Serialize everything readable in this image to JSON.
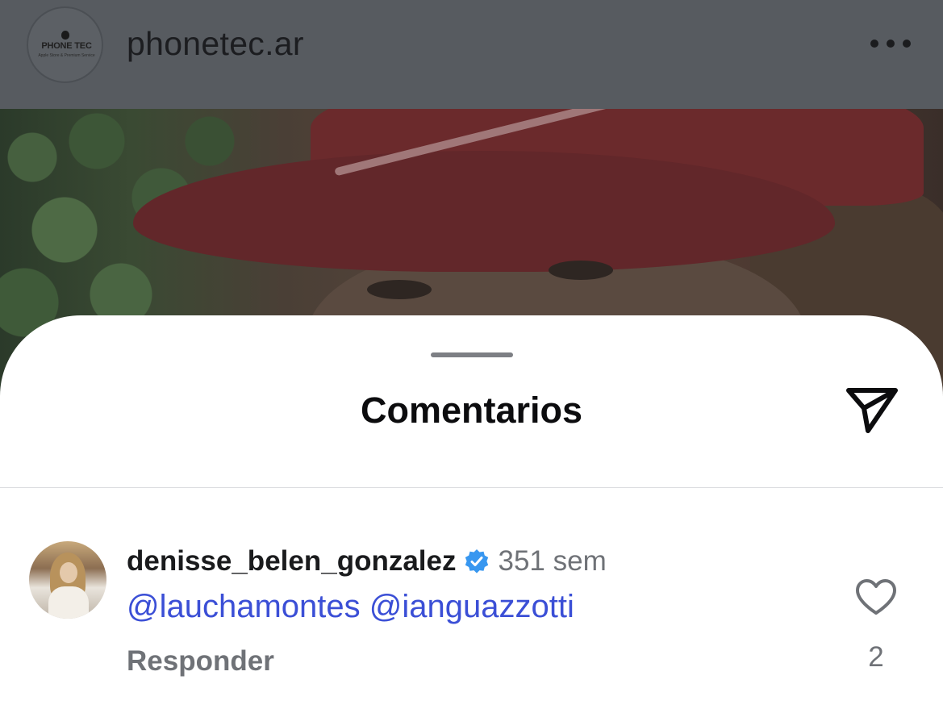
{
  "header": {
    "account_name": "phonetec.ar",
    "avatar": {
      "brand_name": "PHONE TEC",
      "brand_tagline": "Apple Store & Premium Service"
    },
    "more_icon": "more-horizontal-icon"
  },
  "sheet": {
    "title": "Comentarios",
    "share_icon": "send-icon"
  },
  "comment": {
    "username": "denisse_belen_gonzalez",
    "verified": true,
    "time": "351 sem",
    "text": "@lauchamontes @ianguazzotti",
    "reply_label": "Responder",
    "like_count": "2"
  },
  "colors": {
    "mention": "#3b4fd6",
    "verified_badge": "#3897f0",
    "secondary_text": "#6f7277",
    "header_dim": "#575b60"
  }
}
